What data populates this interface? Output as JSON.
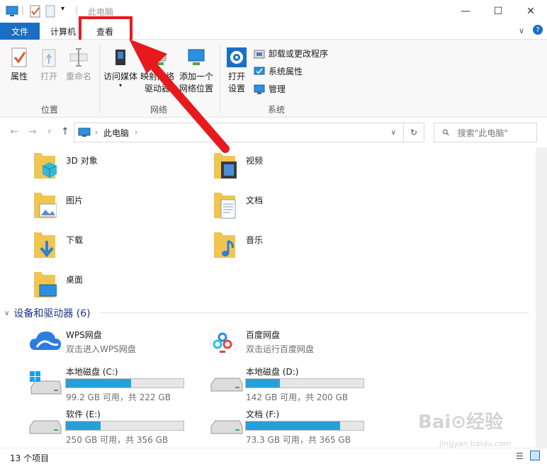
{
  "window": {
    "title": "此电脑",
    "minimize": "—",
    "maximize": "☐",
    "close": "✕"
  },
  "ribbon_tabs": {
    "file": "文件",
    "computer": "计算机",
    "view": "查看",
    "help": "?"
  },
  "ribbon": {
    "location_group": {
      "label": "位置",
      "properties": "属性",
      "open": "打开",
      "rename": "重命名"
    },
    "network_group": {
      "label": "网络",
      "media": "访问媒体",
      "map_drive_1": "映射网络",
      "map_drive_2": "驱动器",
      "add_location_1": "添加一个",
      "add_location_2": "网络位置"
    },
    "system_group": {
      "label": "系统",
      "settings_1": "打开",
      "settings_2": "设置",
      "uninstall": "卸载或更改程序",
      "sys_props": "系统属性",
      "manage": "管理"
    }
  },
  "address": {
    "path": "此电脑",
    "search_placeholder": "搜索\"此电脑\""
  },
  "folders": [
    {
      "name": "3D 对象",
      "icon": "3d-objects"
    },
    {
      "name": "视频",
      "icon": "videos"
    },
    {
      "name": "图片",
      "icon": "pictures"
    },
    {
      "name": "文档",
      "icon": "documents"
    },
    {
      "name": "下载",
      "icon": "downloads"
    },
    {
      "name": "音乐",
      "icon": "music"
    },
    {
      "name": "桌面",
      "icon": "desktop"
    }
  ],
  "devices_section": "设备和驱动器 (6)",
  "drives": [
    {
      "name": "WPS网盘",
      "sub": "双击进入WPS网盘",
      "icon": "wps-cloud"
    },
    {
      "name": "百度网盘",
      "sub": "双击运行百度网盘",
      "icon": "baidu-netdisk"
    },
    {
      "name": "本地磁盘 (C:)",
      "sub": "99.2 GB 可用，共 222 GB",
      "used_fraction": 0.553
    },
    {
      "name": "本地磁盘 (D:)",
      "sub": "142 GB 可用，共 200 GB",
      "used_fraction": 0.29
    },
    {
      "name": "软件 (E:)",
      "sub": "250 GB 可用，共 356 GB",
      "used_fraction": 0.298
    },
    {
      "name": "文档 (F:)",
      "sub": "73.3 GB 可用，共 365 GB",
      "used_fraction": 0.8
    }
  ],
  "status": {
    "count": "13 个项目"
  },
  "colors": {
    "accent": "#1a6fc4",
    "highlight_red": "#e8191c",
    "drive_bar": "#26a0da",
    "section_text": "#1e3287"
  }
}
